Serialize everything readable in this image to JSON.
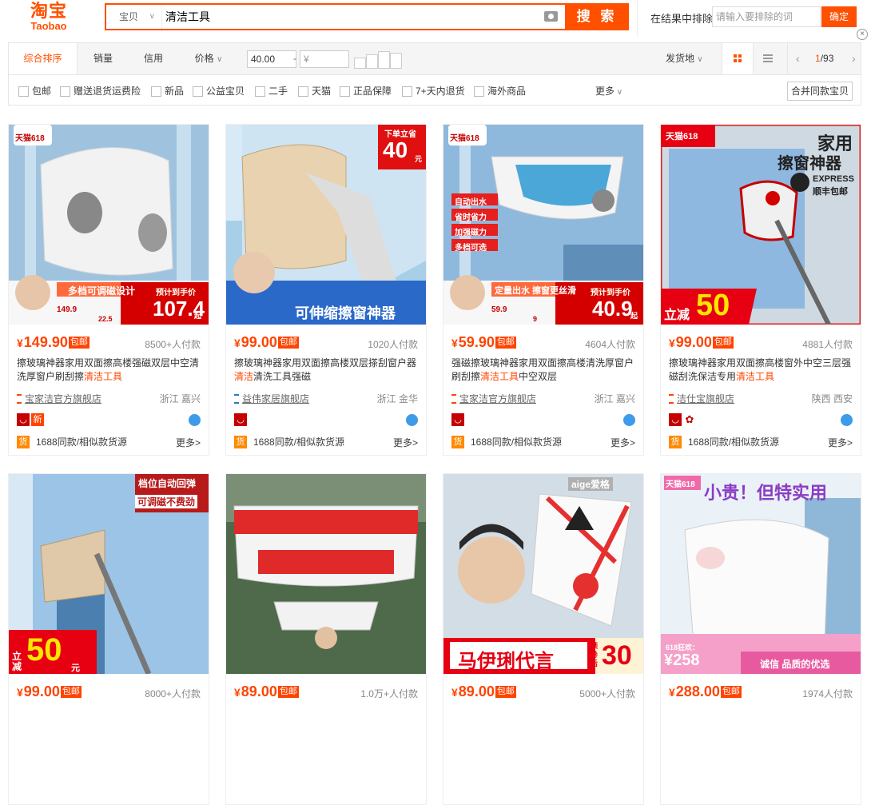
{
  "header": {
    "logo_cn": "淘宝",
    "logo_en": "Taobao",
    "scope": "宝贝",
    "query": "清洁工具",
    "search_button": "搜 索",
    "exclude_label": "在结果中排除",
    "exclude_placeholder": "请输入要排除的词",
    "exclude_button": "确定"
  },
  "sort": {
    "tabs": [
      "综合排序",
      "销量",
      "信用",
      "价格"
    ],
    "price_min": "40.00",
    "price_max_placeholder": "¥",
    "price_dash": "-",
    "ship_from": "发货地",
    "page_current": "1",
    "page_total": "/93"
  },
  "checks": {
    "items": [
      "包邮",
      "赠送退货运费险",
      "新品",
      "公益宝贝",
      "二手",
      "天猫",
      "正品保障",
      "7+天内退货",
      "海外商品"
    ],
    "more": "更多",
    "merge": "合并同款宝贝"
  },
  "products": [
    {
      "price": "149.90",
      "baoyou": "包邮",
      "paid": "8500+人付款",
      "title_a": "擦玻璃神器家用双面擦高楼强磁双层中空清洗厚窗户刷刮擦",
      "title_b": "清洁工具",
      "title_c": "",
      "shop": "宝家洁官方旗舰店",
      "loc": "浙江 嘉兴",
      "src": "1688同款/相似款货源",
      "more": "更多>",
      "xin": "新",
      "img": {
        "badge": "天猫618",
        "stripe": "多档可调磁设计",
        "tag": "预计到手价",
        "big": "107.4",
        "suffix": "起",
        "old": "149.9",
        "x": "22.5"
      }
    },
    {
      "price": "99.00",
      "baoyou": "包邮",
      "paid": "1020人付款",
      "title_a": "擦玻璃神器家用双面擦高楼双层搽刮窗户器",
      "title_b": "清洁",
      "title_c": "清洗工具强磁",
      "shop": "益伟家居旗舰店",
      "loc": "浙江 金华",
      "src": "1688同款/相似款货源",
      "more": "更多>",
      "img": {
        "badge": "下单立省",
        "big": "40",
        "suffix": "元",
        "stripe": "可伸缩擦窗神器"
      }
    },
    {
      "price": "59.90",
      "baoyou": "包邮",
      "paid": "4604人付款",
      "title_a": "强磁擦玻璃神器家用双面擦高楼清洗厚窗户刷刮擦",
      "title_b": "清洁工具",
      "title_c": "中空双层",
      "shop": "宝家洁官方旗舰店",
      "loc": "浙江 嘉兴",
      "src": "1688同款/相似款货源",
      "more": "更多>",
      "img": {
        "badge": "天猫618",
        "features": [
          "自动出水",
          "省时省力",
          "加强磁力",
          "多档可选"
        ],
        "stripe": "定量出水 擦窗更丝滑",
        "tag": "预计到手价",
        "big": "40.9",
        "suffix": "起",
        "old": "59.9",
        "x": "9"
      }
    },
    {
      "price": "99.00",
      "baoyou": "包邮",
      "paid": "4881人付款",
      "title_a": "擦玻璃神器家用双面擦高楼窗外中空三层强磁刮洗保洁专用",
      "title_b": "清洁工具",
      "title_c": "",
      "shop": "洁仕宝旗舰店",
      "loc": "陕西 西安",
      "src": "1688同款/相似款货源",
      "more": "更多>",
      "img": {
        "badge": "天猫618",
        "head1": "家用",
        "head2": "擦窗神器",
        "sf1": "EXPRESS",
        "sf2": "顺丰包邮",
        "big_prefix": "立减",
        "big": "50"
      }
    },
    {
      "price": "99.00",
      "baoyou": "包邮",
      "paid": "8000+人付款",
      "img": {
        "head1": "档位自动回弹",
        "head2": "可调磁不费劲",
        "big_prefix": "立减",
        "big": "50",
        "suffix": "元"
      }
    },
    {
      "price": "89.00",
      "baoyou": "包邮",
      "paid": "1.0万+人付款",
      "img": {}
    },
    {
      "price": "89.00",
      "baoyou": "包邮",
      "paid": "5000+人付款",
      "img": {
        "brand": "aige爱格",
        "stripe": "马伊琍代言",
        "tag": "领卷后",
        "big": "30"
      }
    },
    {
      "price": "288.00",
      "baoyou": "包邮",
      "paid": "1974人付款",
      "img": {
        "badge": "天猫618",
        "head1": "小贵！但特实用",
        "tag": "618狂欢：",
        "big": "¥258",
        "stripe": "诚信 品质的优选"
      }
    }
  ],
  "colors": {
    "accent": "#ff5000",
    "price": "#ff4400",
    "tmall": "#c40000"
  }
}
